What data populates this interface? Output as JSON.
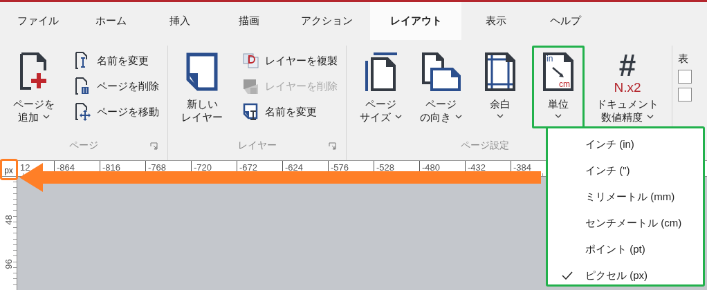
{
  "tabs": [
    {
      "label": "ファイル",
      "selected": false
    },
    {
      "label": "ホーム",
      "selected": false
    },
    {
      "label": "挿入",
      "selected": false
    },
    {
      "label": "描画",
      "selected": false
    },
    {
      "label": "アクション",
      "selected": false
    },
    {
      "label": "レイアウト",
      "selected": true
    },
    {
      "label": "表示",
      "selected": false
    },
    {
      "label": "ヘルプ",
      "selected": false
    }
  ],
  "ribbon": {
    "groups": [
      {
        "label": "ページ",
        "launcher": true,
        "items": [
          {
            "kind": "large",
            "lines": [
              "ページを",
              "追加"
            ],
            "dropdown": true,
            "highlighted": false
          },
          {
            "kind": "stack",
            "items": [
              {
                "label": "名前を変更",
                "disabled": false
              },
              {
                "label": "ページを削除",
                "disabled": false
              },
              {
                "label": "ページを移動",
                "disabled": false
              }
            ]
          }
        ]
      },
      {
        "label": "レイヤー",
        "launcher": true,
        "items": [
          {
            "kind": "large",
            "lines": [
              "新しい",
              "レイヤー"
            ],
            "dropdown": false,
            "highlighted": false
          },
          {
            "kind": "stack",
            "items": [
              {
                "label": "レイヤーを複製",
                "disabled": false
              },
              {
                "label": "レイヤーを削除",
                "disabled": true
              },
              {
                "label": "名前を変更",
                "disabled": false
              }
            ]
          }
        ]
      },
      {
        "label": "ページ設定",
        "launcher": false,
        "items": [
          {
            "kind": "large",
            "lines": [
              "ページ",
              "サイズ"
            ],
            "dropdown": true,
            "highlighted": false
          },
          {
            "kind": "large",
            "lines": [
              "ページ",
              "の向き"
            ],
            "dropdown": true,
            "highlighted": false
          },
          {
            "kind": "large",
            "lines": [
              "余白"
            ],
            "dropdown": true,
            "highlighted": false
          },
          {
            "kind": "large",
            "lines": [
              "単位"
            ],
            "dropdown": true,
            "highlighted": true,
            "icon_text": [
              "in",
              "cm"
            ]
          },
          {
            "kind": "large",
            "lines": [
              "ドキュメント",
              "数値精度"
            ],
            "dropdown": true,
            "highlighted": false,
            "icon_glyph": "#",
            "icon_text": [
              "N.x2"
            ]
          }
        ]
      },
      {
        "kind": "checks",
        "heading": "表",
        "checkboxes": [
          {
            "checked": false
          },
          {
            "checked": false
          }
        ]
      }
    ]
  },
  "ruler": {
    "unit": "px",
    "top_labels": [
      "12",
      "-864",
      "-816",
      "-768",
      "-720",
      "-672",
      "-624",
      "-576",
      "-528",
      "-480",
      "-432",
      "-384"
    ],
    "left_labels": [
      "48",
      "96"
    ]
  },
  "unit_menu": {
    "highlighted": true,
    "items": [
      {
        "label": "インチ (in)",
        "selected": false
      },
      {
        "label": "インチ (\")",
        "selected": false
      },
      {
        "label": "ミリメートル (mm)",
        "selected": false
      },
      {
        "label": "センチメートル (cm)",
        "selected": false
      },
      {
        "label": "ポイント (pt)",
        "selected": false
      },
      {
        "label": "ピクセル (px)",
        "selected": true
      }
    ]
  }
}
